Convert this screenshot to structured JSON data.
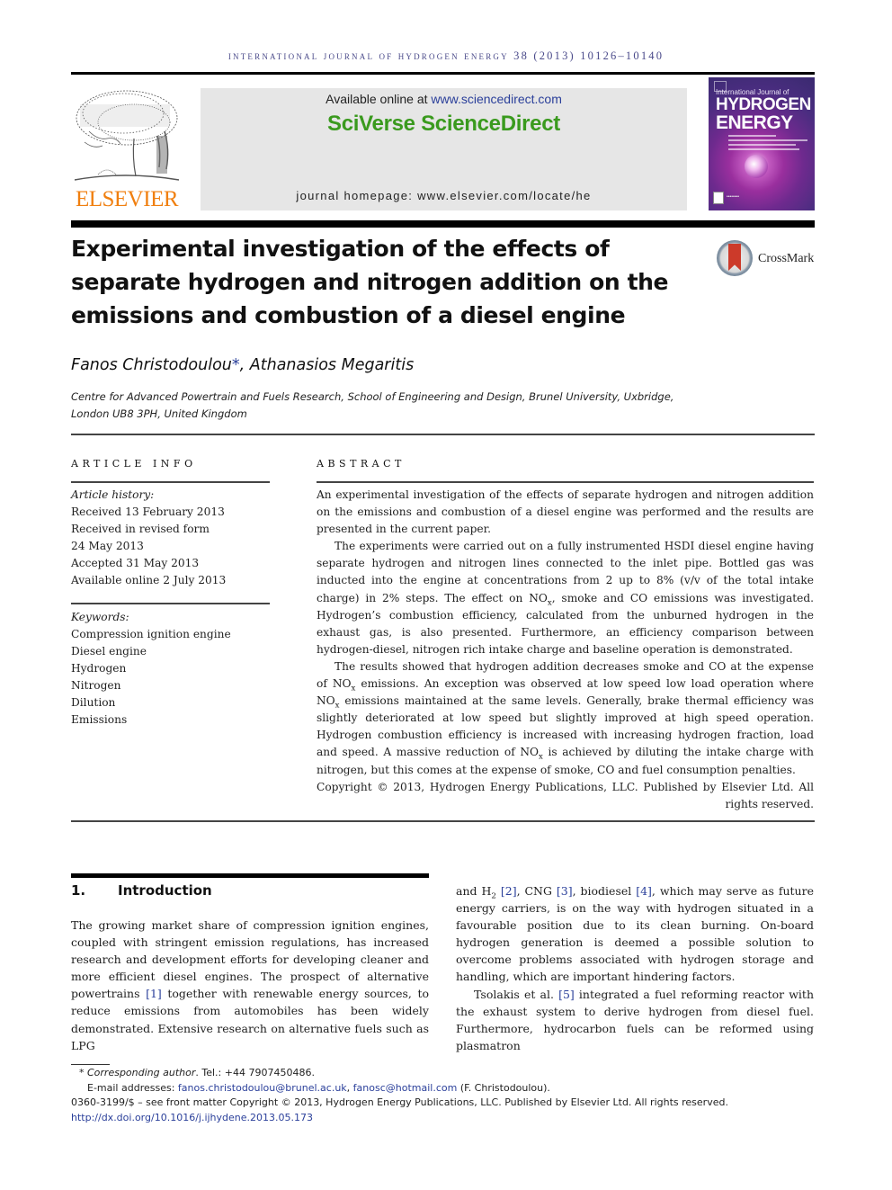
{
  "journal_header": "International Journal of Hydrogen Energy 38 (2013) 10126–10140",
  "publisher": {
    "logo_text": "ELSEVIER",
    "available_online_prefix": "Available online at ",
    "available_online_link": "www.sciencedirect.com",
    "platform_name": "SciVerse ScienceDirect",
    "homepage": "journal homepage: www.elsevier.com/locate/he"
  },
  "journal_cover": {
    "line1": "International Journal of",
    "line2": "HYDROGEN",
    "line3": "ENERGY"
  },
  "crossmark": {
    "label": "CrossMark"
  },
  "article": {
    "title": "Experimental investigation of the effects of separate hydrogen and nitrogen addition on the emissions and combustion of a diesel engine",
    "authors": [
      {
        "name": "Fanos Christodoulou",
        "mark": "*"
      },
      {
        "name": "Athanasios Megaritis",
        "mark": ""
      }
    ],
    "author_separator": ", ",
    "affiliation_line1": "Centre for Advanced Powertrain and Fuels Research, School of Engineering and Design, Brunel University, Uxbridge,",
    "affiliation_line2": "London UB8 3PH, United Kingdom"
  },
  "article_info": {
    "heading": "ARTICLE INFO",
    "history_label": "Article history:",
    "history": [
      "Received 13 February 2013",
      "Received in revised form",
      "24 May 2013",
      "Accepted 31 May 2013",
      "Available online 2 July 2013"
    ],
    "keywords_label": "Keywords:",
    "keywords": [
      "Compression ignition engine",
      "Diesel engine",
      "Hydrogen",
      "Nitrogen",
      "Dilution",
      "Emissions"
    ]
  },
  "abstract": {
    "heading": "ABSTRACT",
    "p1": "An experimental investigation of the effects of separate hydrogen and nitrogen addition on the emissions and combustion of a diesel engine was performed and the results are presented in the current paper.",
    "p2a": "The experiments were carried out on a fully instrumented HSDI diesel engine having separate hydrogen and nitrogen lines connected to the inlet pipe. Bottled gas was inducted into the engine at concentrations from 2 up to 8% (v/v of the total intake charge) in 2% steps. The effect on NO",
    "p2b": ", smoke and CO emissions was investigated. Hydrogen’s combustion efficiency, calculated from the unburned hydrogen in the exhaust gas, is also presented. Furthermore, an efficiency comparison between hydrogen-diesel, nitrogen rich intake charge and baseline operation is demonstrated.",
    "p3a": "The results showed that hydrogen addition decreases smoke and CO at the expense of NO",
    "p3b": " emissions. An exception was observed at low speed low load operation where NO",
    "p3c": " emissions maintained at the same levels. Generally, brake thermal efficiency was slightly deteriorated at low speed but slightly improved at high speed operation. Hydrogen combustion efficiency is increased with increasing hydrogen fraction, load and speed. A massive reduction of NO",
    "p3d": " is achieved by diluting the intake charge with nitrogen, but this comes at the expense of smoke, CO and fuel consumption penalties.",
    "subscript_x": "x",
    "copyright": "Copyright © 2013, Hydrogen Energy Publications, LLC. Published by Elsevier Ltd. All rights reserved."
  },
  "introduction": {
    "number": "1.",
    "heading": "Introduction",
    "left_p1a": "The growing market share of compression ignition engines, coupled with stringent emission regulations, has increased research and development efforts for developing cleaner and more efficient diesel engines. The prospect of alternative powertrains ",
    "ref1": "[1]",
    "left_p1b": " together with renewable energy sources, to reduce emissions from automobiles has been widely demonstrated. Extensive research on alternative fuels such as LPG",
    "right_p1a": "and H",
    "right_sub2": "2",
    "ref2": "[2]",
    "right_p1b": ", CNG ",
    "ref3": "[3]",
    "right_p1c": ", biodiesel ",
    "ref4": "[4]",
    "right_p1d": ", which may serve as future energy carriers, is on the way with hydrogen situated in a favourable position due to its clean burning. On-board hydrogen generation is deemed a possible solution to overcome problems associated with hydrogen storage and handling, which are important hindering factors.",
    "right_p2a": "Tsolakis et al. ",
    "ref5": "[5]",
    "right_p2b": " integrated a fuel reforming reactor with the exhaust system to derive hydrogen from diesel fuel. Furthermore, hydrocarbon fuels can be reformed using plasmatron"
  },
  "footnotes": {
    "star": "*",
    "corr_label": "Corresponding author",
    "corr_tel": ". Tel.: +44 7907450486.",
    "email_prefix": "E-mail addresses: ",
    "email1": "fanos.christodoulou@brunel.ac.uk",
    "email_sep": ", ",
    "email2": "fanosc@hotmail.com",
    "email_suffix": " (F. Christodoulou).",
    "issn_line": "0360-3199/$ – see front matter Copyright © 2013, Hydrogen Energy Publications, LLC. Published by Elsevier Ltd. All rights reserved.",
    "doi": "http://dx.doi.org/10.1016/j.ijhydene.2013.05.173"
  },
  "colors": {
    "link_blue": "#2a3f9a",
    "elsevier_orange": "#f07f0f",
    "sciverse_green": "#3a9a1e",
    "header_box_gray": "#e6e6e6"
  }
}
